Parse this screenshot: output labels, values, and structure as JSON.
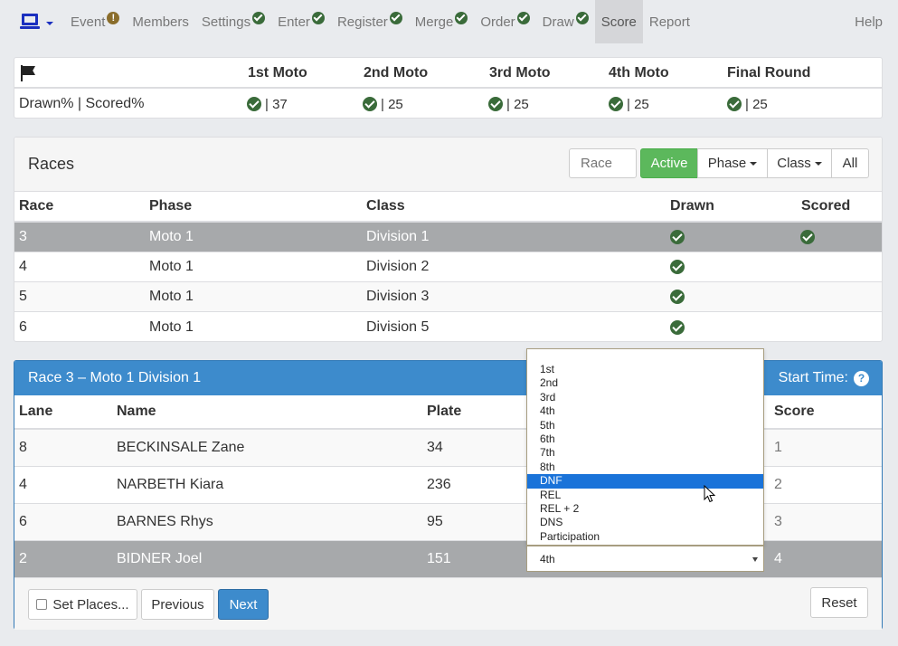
{
  "nav": {
    "items": [
      {
        "label": "Event",
        "status": "warning"
      },
      {
        "label": "Members",
        "status": "none"
      },
      {
        "label": "Settings",
        "status": "check"
      },
      {
        "label": "Enter",
        "status": "check"
      },
      {
        "label": "Register",
        "status": "check"
      },
      {
        "label": "Merge",
        "status": "check"
      },
      {
        "label": "Order",
        "status": "check"
      },
      {
        "label": "Draw",
        "status": "check"
      },
      {
        "label": "Score",
        "status": "active"
      },
      {
        "label": "Report",
        "status": "none"
      }
    ],
    "help": "Help"
  },
  "progress": {
    "row_label": "Drawn% | Scored%",
    "columns": [
      {
        "label": "1st Moto",
        "value": "| 37"
      },
      {
        "label": "2nd Moto",
        "value": "| 25"
      },
      {
        "label": "3rd Moto",
        "value": "| 25"
      },
      {
        "label": "4th Moto",
        "value": "| 25"
      },
      {
        "label": "Final Round",
        "value": "| 25"
      }
    ]
  },
  "races": {
    "title": "Races",
    "filter_placeholder": "Race",
    "buttons": {
      "active": "Active",
      "phase": "Phase",
      "class": "Class",
      "all": "All"
    },
    "headers": {
      "race": "Race",
      "phase": "Phase",
      "class": "Class",
      "drawn": "Drawn",
      "scored": "Scored"
    },
    "rows": [
      {
        "race": "3",
        "phase": "Moto 1",
        "class": "Division 1",
        "drawn": true,
        "scored": true
      },
      {
        "race": "4",
        "phase": "Moto 1",
        "class": "Division 2",
        "drawn": true,
        "scored": false
      },
      {
        "race": "5",
        "phase": "Moto 1",
        "class": "Division 3",
        "drawn": true,
        "scored": false
      },
      {
        "race": "6",
        "phase": "Moto 1",
        "class": "Division 5",
        "drawn": true,
        "scored": false
      }
    ]
  },
  "detail": {
    "title": "Race 3 – Moto 1 Division 1",
    "start_time_label": "Start Time:",
    "headers": {
      "lane": "Lane",
      "name": "Name",
      "plate": "Plate",
      "score": "Score"
    },
    "rows": [
      {
        "lane": "8",
        "name": "BECKINSALE Zane",
        "plate": "34",
        "score": "1"
      },
      {
        "lane": "4",
        "name": "NARBETH Kiara",
        "plate": "236",
        "score": "2"
      },
      {
        "lane": "6",
        "name": "BARNES Rhys",
        "plate": "95",
        "score": "3"
      },
      {
        "lane": "2",
        "name": "BIDNER Joel",
        "plate": "151",
        "score": "4"
      }
    ],
    "buttons": {
      "set_places": "Set Places...",
      "previous": "Previous",
      "next": "Next",
      "reset": "Reset"
    }
  },
  "place_select": {
    "selected": "4th",
    "highlighted": "DNF",
    "options": [
      "1st",
      "2nd",
      "3rd",
      "4th",
      "5th",
      "6th",
      "7th",
      "8th",
      "DNF",
      "REL",
      "REL + 2",
      "DNS",
      "Participation"
    ]
  },
  "colors": {
    "accent": "#3d8bcc",
    "success": "#5cb85c",
    "check": "#3a6b3a",
    "selected_row": "#a7a9ab"
  }
}
